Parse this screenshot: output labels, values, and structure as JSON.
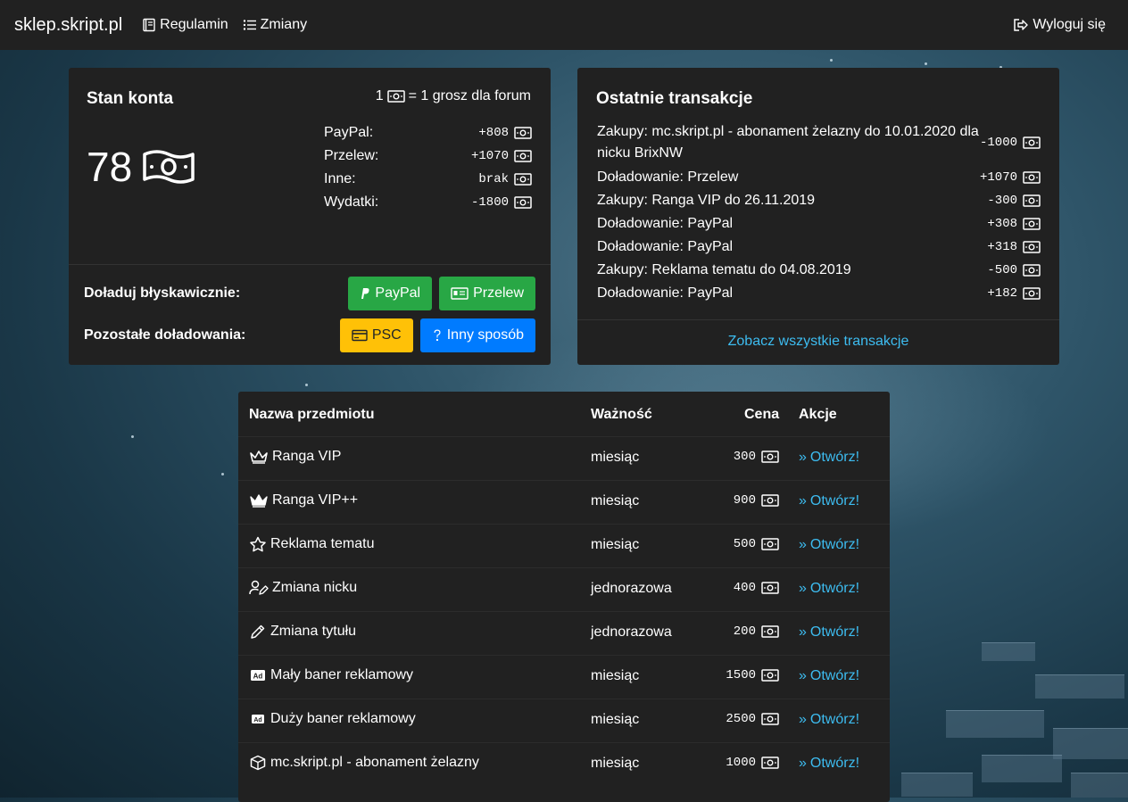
{
  "nav": {
    "brand": "sklep.skript.pl",
    "links": [
      {
        "label": "Regulamin",
        "icon": "book-icon"
      },
      {
        "label": "Zmiany",
        "icon": "list-icon"
      }
    ],
    "logout": {
      "label": "Wyloguj się",
      "icon": "logout-icon"
    }
  },
  "account": {
    "title": "Stan konta",
    "rate_prefix": "1",
    "rate_suffix": "= 1 grosz dla forum",
    "balance": "78",
    "stats": [
      {
        "label": "PayPal:",
        "value": "+808"
      },
      {
        "label": "Przelew:",
        "value": "+1070"
      },
      {
        "label": "Inne:",
        "value": "brak"
      },
      {
        "label": "Wydatki:",
        "value": "-1800"
      }
    ],
    "instant_label": "Doładuj błyskawicznie:",
    "other_label": "Pozostałe doładowania:",
    "buttons": {
      "paypal": "PayPal",
      "transfer": "Przelew",
      "psc": "PSC",
      "other": "Inny sposób"
    }
  },
  "transactions": {
    "title": "Ostatnie transakcje",
    "items": [
      {
        "desc": "Zakupy: mc.skript.pl - abonament żelazny do 10.01.2020 dla nicku BrixNW",
        "amount": "-1000"
      },
      {
        "desc": "Doładowanie: Przelew",
        "amount": "+1070"
      },
      {
        "desc": "Zakupy: Ranga VIP do 26.11.2019",
        "amount": "-300"
      },
      {
        "desc": "Doładowanie: PayPal",
        "amount": "+308"
      },
      {
        "desc": "Doładowanie: PayPal",
        "amount": "+318"
      },
      {
        "desc": "Zakupy: Reklama tematu do 04.08.2019",
        "amount": "-500"
      },
      {
        "desc": "Doładowanie: PayPal",
        "amount": "+182"
      }
    ],
    "more_link": "Zobacz wszystkie transakcje"
  },
  "items_table": {
    "headers": {
      "name": "Nazwa przedmiotu",
      "validity": "Ważność",
      "price": "Cena",
      "actions": "Akcje"
    },
    "action_label": "Otwórz!",
    "rows": [
      {
        "name": "Ranga VIP",
        "validity": "miesiąc",
        "price": "300",
        "icon": "crown-outline-icon"
      },
      {
        "name": "Ranga VIP++",
        "validity": "miesiąc",
        "price": "900",
        "icon": "crown-filled-icon"
      },
      {
        "name": "Reklama tematu",
        "validity": "miesiąc",
        "price": "500",
        "icon": "star-icon"
      },
      {
        "name": "Zmiana nicku",
        "validity": "jednorazowa",
        "price": "400",
        "icon": "user-edit-icon"
      },
      {
        "name": "Zmiana tytułu",
        "validity": "jednorazowa",
        "price": "200",
        "icon": "pencil-icon"
      },
      {
        "name": "Mały baner reklamowy",
        "validity": "miesiąc",
        "price": "1500",
        "icon": "ad-icon"
      },
      {
        "name": "Duży baner reklamowy",
        "validity": "miesiąc",
        "price": "2500",
        "icon": "ad-icon"
      },
      {
        "name": "mc.skript.pl - abonament żelazny",
        "validity": "miesiąc",
        "price": "1000",
        "icon": "cube-icon"
      }
    ]
  }
}
